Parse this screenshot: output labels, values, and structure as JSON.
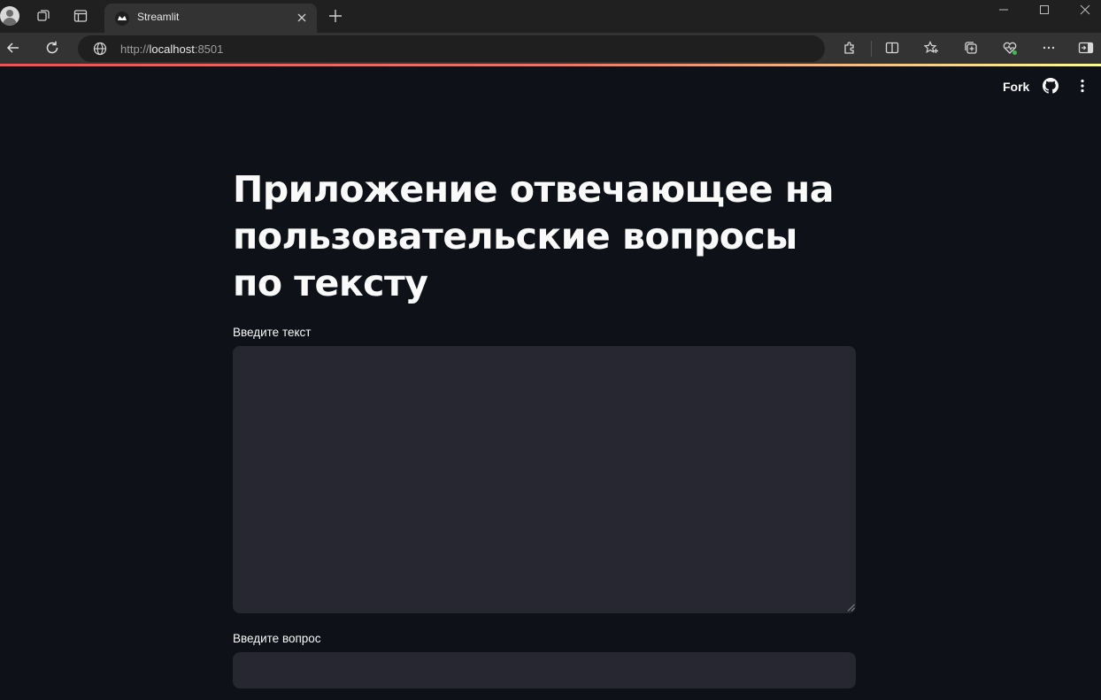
{
  "browser": {
    "tab": {
      "title": "Streamlit"
    },
    "address": {
      "scheme": "http://",
      "host": "localhost",
      "port": ":8501"
    }
  },
  "app": {
    "header": {
      "fork_label": "Fork"
    },
    "title": "Приложение отвечающее на пользовательские вопросы по тексту",
    "text_input": {
      "label": "Введите текст",
      "value": "",
      "placeholder": ""
    },
    "question_input": {
      "label": "Введите вопрос",
      "value": "",
      "placeholder": ""
    }
  },
  "colors": {
    "background": "#0e1117",
    "input_bg": "#262730",
    "text": "#fafafa",
    "accent_gradient": [
      "#ff4b4b",
      "#fffd80"
    ]
  },
  "icons": {
    "tabbar": [
      "profile-icon",
      "workspaces-icon",
      "tab-actions-icon",
      "streamlit-favicon",
      "close-icon",
      "new-tab-icon",
      "minimize-icon",
      "maximize-icon",
      "close-window-icon"
    ],
    "toolbar": [
      "back-icon",
      "refresh-icon",
      "globe-icon",
      "extensions-icon",
      "split-screen-icon",
      "favorites-icon",
      "collections-icon",
      "performance-icon",
      "more-icon",
      "sidebar-icon"
    ],
    "app": [
      "github-icon",
      "kebab-menu-icon"
    ]
  }
}
